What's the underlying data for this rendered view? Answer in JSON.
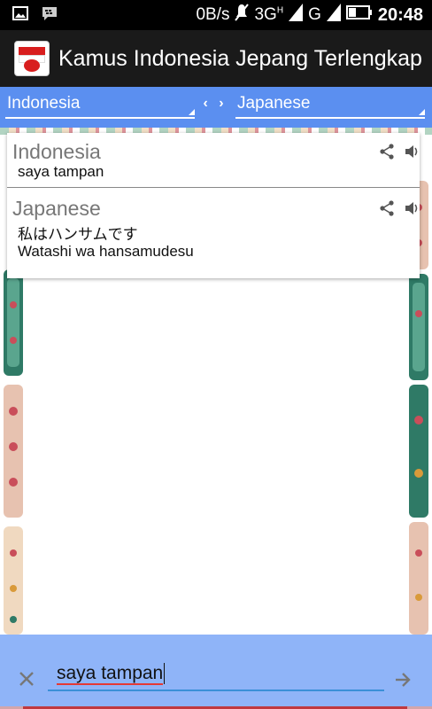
{
  "status_bar": {
    "data_rate": "0B/s",
    "network_3g": "3G",
    "network_h": "H",
    "network_g": "G",
    "time": "20:48",
    "icons": [
      "image-icon",
      "bbm-icon",
      "mute-icon",
      "signal-icon",
      "battery-icon"
    ]
  },
  "app_bar": {
    "title": "Kamus Indonesia Jepang Terlengkap",
    "icon": "app-flag-icon"
  },
  "language_bar": {
    "source_language": "Indonesia",
    "target_language": "Japanese",
    "swap_label": "‹ ›"
  },
  "result": {
    "source": {
      "label": "Indonesia",
      "text": "saya tampan"
    },
    "target": {
      "label": "Japanese",
      "text": "私はハンサムです",
      "romaji": "Watashi wa hansamudesu"
    }
  },
  "input": {
    "value": "saya tampan",
    "clear_label": "×",
    "submit_label": "→"
  },
  "colors": {
    "accent": "#5b8ff0",
    "input_bar": "#8fb4f8",
    "underline": "#3a8fd8"
  }
}
